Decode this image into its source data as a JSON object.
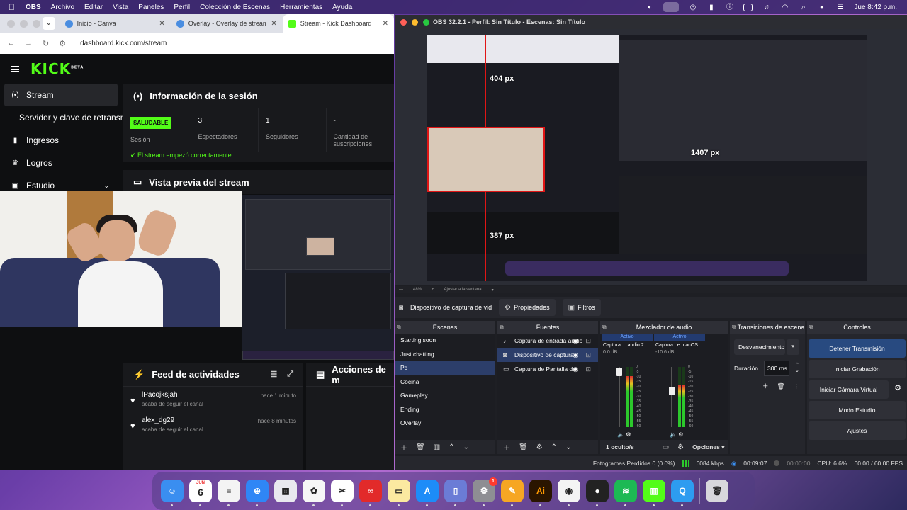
{
  "menubar": {
    "items": [
      "OBS",
      "Archivo",
      "Editar",
      "Vista",
      "Paneles",
      "Perfil",
      "Colección de Escenas",
      "Herramientas",
      "Ayuda"
    ],
    "clock": "Jue 8:42 p.m."
  },
  "browser": {
    "tabs": [
      {
        "label": "Inicio - Canva"
      },
      {
        "label": "Overlay - Overlay de streaming"
      },
      {
        "label": "Stream - Kick Dashboard"
      }
    ],
    "url": "dashboard.kick.com/stream"
  },
  "kick": {
    "logo": "KICK",
    "logo_badge": "BETA",
    "sidebar": [
      {
        "label": "Stream",
        "icon": "broadcast-icon"
      },
      {
        "label": "Servidor y clave de retransmisión",
        "icon": ""
      },
      {
        "label": "Ingresos",
        "icon": "chart-icon"
      },
      {
        "label": "Logros",
        "icon": "trophy-icon"
      },
      {
        "label": "Estudio",
        "icon": "studio-icon"
      }
    ],
    "session": {
      "title": "Información de la sesión",
      "status_badge": "SALUDABLE",
      "status_label": "Sesión",
      "viewers_value": "3",
      "viewers_label": "Espectadores",
      "followers_value": "1",
      "followers_label": "Seguidores",
      "subs_value": "-",
      "subs_label": "Cantidad de suscripciones",
      "ok_message": "El stream empezó correctamente"
    },
    "preview_title": "Vista previa del stream",
    "feed": {
      "title": "Feed de actividades",
      "items": [
        {
          "name": "lPacojksjah",
          "text": "acaba de seguir el canal",
          "time": "hace 1 minuto"
        },
        {
          "name": "alex_dg29",
          "text": "acaba de seguir el canal",
          "time": "hace 8 minutos"
        }
      ]
    },
    "actions_title": "Acciones de m"
  },
  "obs": {
    "title": "OBS 32.2.1 - Perfil: Sin Título - Escenas: Sin Título",
    "preview": {
      "width_label": "404 px",
      "width2_label": "1407 px",
      "height_label": "387 px"
    },
    "zoom": "48%",
    "zoom_mode": "Ajustar a la ventana",
    "source_bar": {
      "name": "Dispositivo de captura de vid",
      "props": "Propiedades",
      "filters": "Filtros"
    },
    "docks": {
      "scenes": "Escenas",
      "sources": "Fuentes",
      "mixer": "Mezclador de audio",
      "transitions": "Transiciones de escena",
      "controls": "Controles"
    },
    "scenes": [
      "Starting soon",
      "Just chatting",
      "Pc",
      "Cocina",
      "Gameplay",
      "Ending",
      "Overlay"
    ],
    "selected_scene": "Pc",
    "sources": [
      {
        "label": "Captura de entrada audio",
        "icon": "mic-icon"
      },
      {
        "label": "Dispositivo de captura",
        "icon": "camera-icon"
      },
      {
        "label": "Captura de Pantalla de",
        "icon": "monitor-icon"
      }
    ],
    "mixer": {
      "channels": [
        {
          "active": "Activo",
          "name": "Captura ... audio 2",
          "db": "0.0 dB",
          "level": 0.85,
          "fader": 0.92
        },
        {
          "active": "Activo",
          "name": "Captura...e macOS",
          "db": "-10.6 dB",
          "level": 0.7,
          "fader": 0.6
        }
      ],
      "ticks": [
        "0",
        "-5",
        "-10",
        "-15",
        "-20",
        "-25",
        "-30",
        "-35",
        "-40",
        "-45",
        "-50",
        "-55",
        "-60"
      ],
      "hidden": "1 oculto/s",
      "options": "Opciones"
    },
    "transitions": {
      "type": "Desvanecimiento",
      "duration_label": "Duración",
      "duration": "300 ms"
    },
    "controls": [
      "Detener Transmisión",
      "Iniciar Grabación",
      "Iniciar Cámara Virtual",
      "Modo Estudio",
      "Ajustes"
    ],
    "status": {
      "dropped": "Fotogramas Perdidos 0 (0.0%)",
      "bitrate": "6084 kbps",
      "stream_time": "00:09:07",
      "rec_time": "00:00:00",
      "cpu": "CPU: 6.6%",
      "fps": "60.00 / 60.00 FPS"
    }
  },
  "dock_apps": [
    {
      "name": "finder",
      "color": "#3a8ef0",
      "glyph": "☺"
    },
    {
      "name": "calendar",
      "color": "#ffffff",
      "glyph": "6"
    },
    {
      "name": "reminders",
      "color": "#f4f4f4",
      "glyph": "≡"
    },
    {
      "name": "safari",
      "color": "#2f86f6",
      "glyph": "⊕"
    },
    {
      "name": "launchpad",
      "color": "#e8e8ee",
      "glyph": "▦"
    },
    {
      "name": "photos",
      "color": "#f6f6f6",
      "glyph": "✿"
    },
    {
      "name": "capcut",
      "color": "#ffffff",
      "glyph": "✂"
    },
    {
      "name": "creative-cloud",
      "color": "#e22a2a",
      "glyph": "∞"
    },
    {
      "name": "notes",
      "color": "#fbe9a0",
      "glyph": "▭"
    },
    {
      "name": "app-store",
      "color": "#1d8cf8",
      "glyph": "A"
    },
    {
      "name": "preview",
      "color": "#6b7cd6",
      "glyph": "▯"
    },
    {
      "name": "system-settings",
      "color": "#8e8e93",
      "glyph": "⚙",
      "badge": "1"
    },
    {
      "name": "pages",
      "color": "#f6a623",
      "glyph": "✎"
    },
    {
      "name": "illustrator",
      "color": "#2a1500",
      "glyph": "Ai"
    },
    {
      "name": "chrome",
      "color": "#f4f4f4",
      "glyph": "◉"
    },
    {
      "name": "obs",
      "color": "#222",
      "glyph": "●"
    },
    {
      "name": "spotify",
      "color": "#1db954",
      "glyph": "≋"
    },
    {
      "name": "kick-app",
      "color": "#53fc18",
      "glyph": "▥"
    },
    {
      "name": "quicktime",
      "color": "#2d9cf0",
      "glyph": "Q"
    },
    {
      "name": "trash",
      "color": "#d8d8dc",
      "glyph": "🗑"
    }
  ],
  "dock_extra": {
    "calendar_month": "JUN"
  }
}
